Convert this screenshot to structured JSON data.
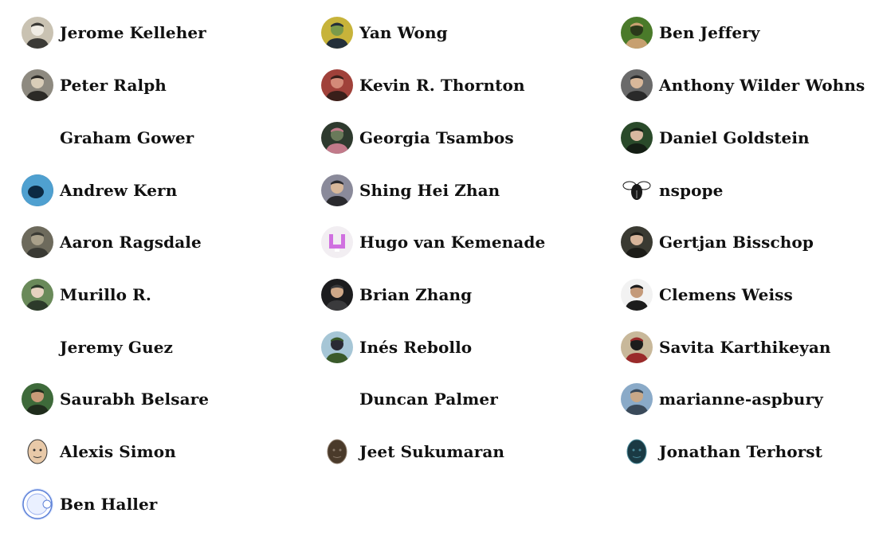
{
  "contributors": [
    {
      "name": "Jerome Kelleher",
      "avatar": "photo-bearded-man",
      "colors": [
        "#c9c2b2",
        "#3b3a36",
        "#f0ece4"
      ]
    },
    {
      "name": "Peter Ralph",
      "avatar": "photo-man-hat",
      "colors": [
        "#8e8a80",
        "#2c2a26",
        "#d9cdb8"
      ]
    },
    {
      "name": "Graham Gower",
      "avatar": "none"
    },
    {
      "name": "Andrew Kern",
      "avatar": "photo-underwater",
      "colors": [
        "#1c5f8f",
        "#0c2a44",
        "#4fa0d0"
      ]
    },
    {
      "name": "Aaron Ragsdale",
      "avatar": "photo-outdoor",
      "colors": [
        "#6d6a5c",
        "#3a3a34",
        "#a9a08a"
      ]
    },
    {
      "name": "Murillo R.",
      "avatar": "photo-man-glasses",
      "colors": [
        "#6a8a5a",
        "#2c3a2a",
        "#e6d2c0"
      ]
    },
    {
      "name": "Jeremy Guez",
      "avatar": "none"
    },
    {
      "name": "Saurabh Belsare",
      "avatar": "photo-man-green",
      "colors": [
        "#3e6a3a",
        "#1f2c1c",
        "#c99a78"
      ]
    },
    {
      "name": "Alexis Simon",
      "avatar": "cartoon-magnifier",
      "colors": [
        "#ffffff",
        "#333333",
        "#e8c9a8"
      ]
    },
    {
      "name": "Ben Haller",
      "avatar": "blue-cell-drawing",
      "colors": [
        "#dfe9ff",
        "#5b7fd6",
        "#ffffff"
      ]
    },
    {
      "name": "Yan Wong",
      "avatar": "photo-yellow-green",
      "colors": [
        "#c7b33a",
        "#24303a",
        "#7a9a4a"
      ]
    },
    {
      "name": "Kevin R. Thornton",
      "avatar": "photo-red-wall",
      "colors": [
        "#a0413a",
        "#3a1f1a",
        "#d48a78"
      ]
    },
    {
      "name": "Georgia Tsambos",
      "avatar": "photo-pink-flowers",
      "colors": [
        "#2e3a2e",
        "#c27a8a",
        "#6a7a5a"
      ]
    },
    {
      "name": "Shing Hei Zhan",
      "avatar": "photo-smiling",
      "colors": [
        "#8a8a9a",
        "#2a2a2e",
        "#d8b89a"
      ]
    },
    {
      "name": "Hugo van Kemenade",
      "avatar": "pink-pixel-logo",
      "colors": [
        "#f2eef2",
        "#d070e0",
        "#ffffff"
      ]
    },
    {
      "name": "Brian Zhang",
      "avatar": "photo-dark-shirt",
      "colors": [
        "#1c1c1e",
        "#3a3a3c",
        "#cfa888"
      ]
    },
    {
      "name": "Inés Rebollo",
      "avatar": "photo-field-hat",
      "colors": [
        "#a6c6d6",
        "#3a5a2a",
        "#2a2a34"
      ]
    },
    {
      "name": "Duncan Palmer",
      "avatar": "none"
    },
    {
      "name": "Jeet Sukumaran",
      "avatar": "sketch-hairy-face",
      "colors": [
        "#ffffff",
        "#8a7a6a",
        "#4a3a2a"
      ]
    },
    {
      "name": "Ben Jeffery",
      "avatar": "photo-man-green-bg",
      "colors": [
        "#4a7a2a",
        "#c7a070",
        "#2a3a1a"
      ]
    },
    {
      "name": "Anthony Wilder Wohns",
      "avatar": "photo-grey-bg",
      "colors": [
        "#6a6a6a",
        "#2a2a2a",
        "#d9b89a"
      ]
    },
    {
      "name": "Daniel Goldstein",
      "avatar": "photo-forest",
      "colors": [
        "#2a4a2a",
        "#141e14",
        "#d8b8a0"
      ]
    },
    {
      "name": "nspope",
      "avatar": "bee-drawing",
      "colors": [
        "#ffffff",
        "#1a1a1a",
        "#9a9a9a"
      ]
    },
    {
      "name": "Gertjan Bisschop",
      "avatar": "photo-glasses-dark",
      "colors": [
        "#3a3a32",
        "#1c1c18",
        "#d6b49a"
      ]
    },
    {
      "name": "Clemens Weiss",
      "avatar": "photo-beanie",
      "colors": [
        "#f2f2f2",
        "#1c1c1c",
        "#c49a7a"
      ]
    },
    {
      "name": "Savita Karthikeyan",
      "avatar": "photo-woman-red",
      "colors": [
        "#c8b89a",
        "#9a2a2a",
        "#1c1c1c"
      ]
    },
    {
      "name": "marianne-aspbury",
      "avatar": "photo-seaside",
      "colors": [
        "#8aaac8",
        "#3a4a5a",
        "#c8a888"
      ]
    },
    {
      "name": "Jonathan Terhorst",
      "avatar": "cartoon-teal-face",
      "colors": [
        "#ffffff",
        "#4a8a9a",
        "#1a3a44"
      ]
    }
  ]
}
